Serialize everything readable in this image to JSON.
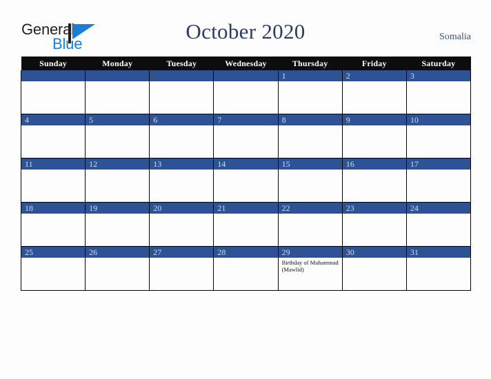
{
  "brand": {
    "name_part1": "General",
    "name_part2": "Blue",
    "logo_icon": "flag-triangle-icon"
  },
  "header": {
    "title": "October 2020",
    "country": "Somalia"
  },
  "calendar": {
    "weekday_headers": [
      "Sunday",
      "Monday",
      "Tuesday",
      "Wednesday",
      "Thursday",
      "Friday",
      "Saturday"
    ],
    "accent_color": "#2e5394",
    "header_bar_color": "#0d0d0d",
    "title_color": "#2b3c63",
    "weeks": [
      [
        {
          "day": "",
          "events": []
        },
        {
          "day": "",
          "events": []
        },
        {
          "day": "",
          "events": []
        },
        {
          "day": "",
          "events": []
        },
        {
          "day": "1",
          "events": []
        },
        {
          "day": "2",
          "events": []
        },
        {
          "day": "3",
          "events": []
        }
      ],
      [
        {
          "day": "4",
          "events": []
        },
        {
          "day": "5",
          "events": []
        },
        {
          "day": "6",
          "events": []
        },
        {
          "day": "7",
          "events": []
        },
        {
          "day": "8",
          "events": []
        },
        {
          "day": "9",
          "events": []
        },
        {
          "day": "10",
          "events": []
        }
      ],
      [
        {
          "day": "11",
          "events": []
        },
        {
          "day": "12",
          "events": []
        },
        {
          "day": "13",
          "events": []
        },
        {
          "day": "14",
          "events": []
        },
        {
          "day": "15",
          "events": []
        },
        {
          "day": "16",
          "events": []
        },
        {
          "day": "17",
          "events": []
        }
      ],
      [
        {
          "day": "18",
          "events": []
        },
        {
          "day": "19",
          "events": []
        },
        {
          "day": "20",
          "events": []
        },
        {
          "day": "21",
          "events": []
        },
        {
          "day": "22",
          "events": []
        },
        {
          "day": "23",
          "events": []
        },
        {
          "day": "24",
          "events": []
        }
      ],
      [
        {
          "day": "25",
          "events": []
        },
        {
          "day": "26",
          "events": []
        },
        {
          "day": "27",
          "events": []
        },
        {
          "day": "28",
          "events": []
        },
        {
          "day": "29",
          "events": [
            "Birthday of Muhammad (Mawlid)"
          ]
        },
        {
          "day": "30",
          "events": []
        },
        {
          "day": "31",
          "events": []
        }
      ]
    ]
  }
}
